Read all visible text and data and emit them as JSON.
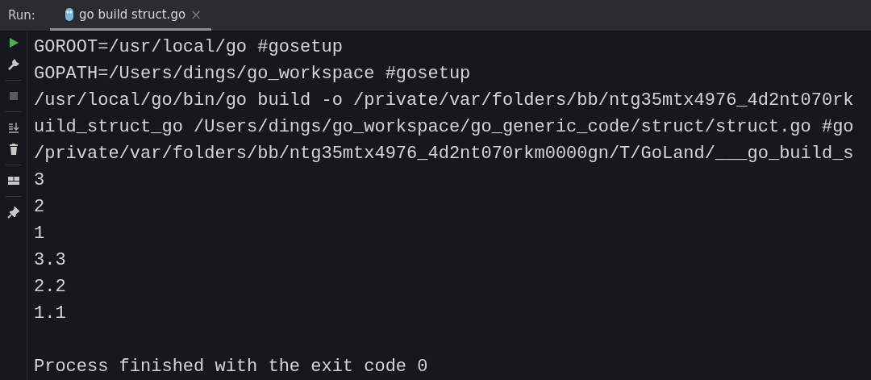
{
  "run_panel": {
    "label": "Run:",
    "tab": {
      "title": "go build struct.go",
      "selected": true,
      "close": "×"
    }
  },
  "toolbar": [
    {
      "kind": "run",
      "disabled": false
    },
    {
      "kind": "settings",
      "disabled": false
    },
    {
      "kind": "stop",
      "disabled": true
    },
    {
      "kind": "scroll",
      "disabled": false
    },
    {
      "kind": "trash",
      "disabled": false
    },
    {
      "kind": "layout",
      "disabled": false
    },
    {
      "kind": "pin",
      "disabled": false
    }
  ],
  "console_lines": [
    "GOROOT=/usr/local/go #gosetup",
    "GOPATH=/Users/dings/go_workspace #gosetup",
    "/usr/local/go/bin/go build -o /private/var/folders/bb/ntg35mtx4976_4d2nt070rk",
    "uild_struct_go /Users/dings/go_workspace/go_generic_code/struct/struct.go #go",
    "/private/var/folders/bb/ntg35mtx4976_4d2nt070rkm0000gn/T/GoLand/___go_build_s",
    "3",
    "2",
    "1",
    "3.3",
    "2.2",
    "1.1"
  ],
  "exit_message": "Process finished with the exit code 0"
}
